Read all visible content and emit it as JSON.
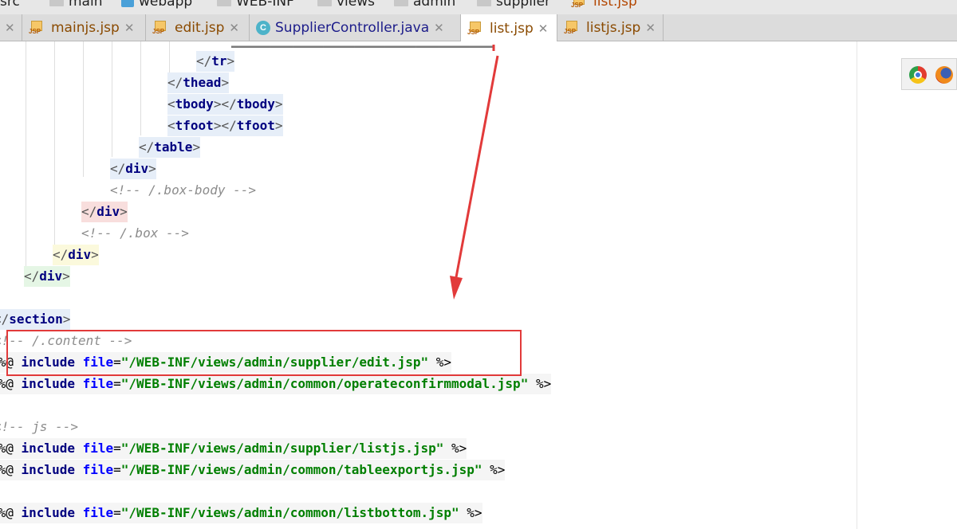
{
  "breadcrumb": {
    "items": [
      "src",
      "main",
      "webapp",
      "WEB-INF",
      "views",
      "admin",
      "supplier",
      "list.jsp"
    ]
  },
  "tabs": [
    {
      "label": "mainjs.jsp",
      "icon": "jsp-file-icon",
      "active": false
    },
    {
      "label": "edit.jsp",
      "icon": "jsp-file-icon",
      "active": false
    },
    {
      "label": "SupplierController.java",
      "icon": "java-class-icon",
      "active": false
    },
    {
      "label": "list.jsp",
      "icon": "jsp-file-icon",
      "active": true
    },
    {
      "label": "listjs.jsp",
      "icon": "jsp-file-icon",
      "active": false
    }
  ],
  "editor": {
    "lines": {
      "tr": "tr",
      "thead": "thead",
      "tbody": "tbody",
      "tfoot": "tfoot",
      "table": "table",
      "div": "div",
      "section": "section",
      "box_body_comment": "<!-- /.box-body -->",
      "box_comment": "<!-- /.box -->",
      "content_comment": "<!-- /.content -->",
      "js_comment": "<!-- js -->",
      "include_kw": "include",
      "file_attr": "file",
      "inc_edit": "\"/WEB-INF/views/admin/supplier/edit.jsp\"",
      "inc_operate": "\"/WEB-INF/views/admin/common/operateconfirmmodal.jsp\"",
      "inc_listjs": "\"/WEB-INF/views/admin/supplier/listjs.jsp\"",
      "inc_tableexport": "\"/WEB-INF/views/admin/common/tableexportjs.jsp\"",
      "inc_listbottom": "\"/WEB-INF/views/admin/common/listbottom.jsp\""
    }
  },
  "browser_icons": [
    "chrome-icon",
    "firefox-icon"
  ],
  "colors": {
    "annotation": "#e23a3a",
    "tag": "#00007f",
    "string": "#007f00",
    "comment": "#8c8c8c"
  }
}
